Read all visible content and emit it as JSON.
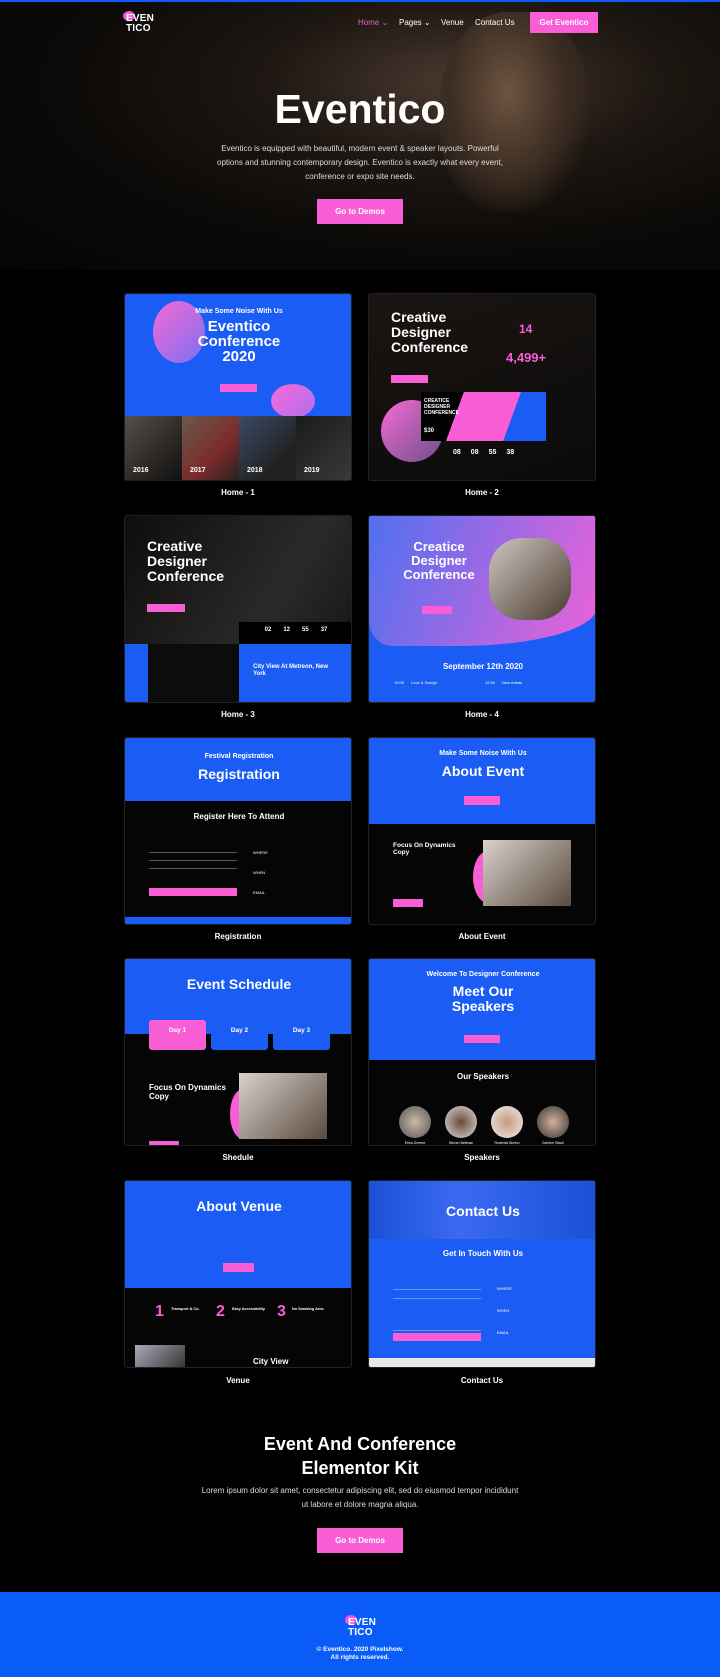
{
  "colors": {
    "accent": "#fa5ed6",
    "brand_blue": "#0a5cf8",
    "background": "#000000"
  },
  "header": {
    "logo": [
      "EVEN",
      "TICO"
    ],
    "nav": [
      {
        "label": "Home",
        "active": true,
        "dropdown": true
      },
      {
        "label": "Pages",
        "dropdown": true
      },
      {
        "label": "Venue"
      },
      {
        "label": "Contact Us"
      }
    ],
    "cta": "Get Eventico",
    "chevron_icon": "chevron-down-icon"
  },
  "hero": {
    "title": "Eventico",
    "text": "Eventico is equipped with beautiful, modern event & speaker layouts. Powerful options and stunning contemporary design. Eventico is exactly what every event, conference or expo site needs.",
    "button": "Go to Demos"
  },
  "demos": [
    {
      "label": "Home - 1",
      "kicker": "Make Some Noise With Us",
      "title": "Eventico Conference 2020",
      "years": [
        "2016",
        "2017",
        "2018",
        "2019"
      ]
    },
    {
      "label": "Home - 2",
      "title": "Creative Designer Conference",
      "stat1": "14",
      "stat2": "4,499+",
      "ticket": "CREATICE DESIGNER CONFERENCE",
      "price": "$30",
      "countdown": [
        "08",
        "08",
        "55",
        "38"
      ]
    },
    {
      "label": "Home - 3",
      "title": "Creative Designer Conference",
      "countdown": [
        "02",
        "12",
        "55",
        "37"
      ],
      "subtitle": "City View At Metreon, New York"
    },
    {
      "label": "Home - 4",
      "title": "Creatice Designer Conference",
      "date": "September 12th 2020",
      "items": [
        "Love & Design",
        "New Artists"
      ],
      "times": [
        "10:00",
        "12:00"
      ]
    },
    {
      "label": "Registration",
      "kicker": "Festival Registration",
      "title": "Registration",
      "subtitle": "Register Here To Attend",
      "info": [
        "WHERE",
        "WHEN",
        "EMAIL"
      ]
    },
    {
      "label": "About Event",
      "kicker": "Make Some Noise With Us",
      "title": "About Event",
      "subtitle": "Focus On Dynamics Copy"
    },
    {
      "label": "Shedule",
      "title": "Event Schedule",
      "days": [
        "Day 1",
        "Day 2",
        "Day 3"
      ],
      "subtitle": "Focus On Dynamics Copy"
    },
    {
      "label": "Speakers",
      "kicker": "Welcome To Designer Conference",
      "title": "Meet Our Speakers",
      "subtitle": "Our Speakers",
      "speakers": [
        "Erica Greene",
        "Steven Bellman",
        "Roderick Burton",
        "Carlene Stach"
      ]
    },
    {
      "label": "Venue",
      "title": "About Venue",
      "features": [
        "Transport & Co.",
        "Easy Accessibility",
        "No Smoking Area"
      ],
      "numbers": [
        "1",
        "2",
        "3"
      ],
      "footer_title": "City View"
    },
    {
      "label": "Contact Us",
      "title": "Contact Us",
      "subtitle": "Get In Touch With Us",
      "info": [
        "WHERE",
        "WHEN",
        "EMAIL"
      ]
    }
  ],
  "cta_section": {
    "title": "Event And Conference Elementor Kit",
    "text": "Lorem ipsum dolor sit amet, consectetur adipiscing elit, sed do eiusmod tempor incididunt ut labore et dolore magna aliqua.",
    "button": "Go to Demos"
  },
  "footer": {
    "logo": [
      "EVEN",
      "TICO"
    ],
    "copyright": "© Eventico. 2020 Pixelshow.",
    "rights": "All rights reserved."
  }
}
